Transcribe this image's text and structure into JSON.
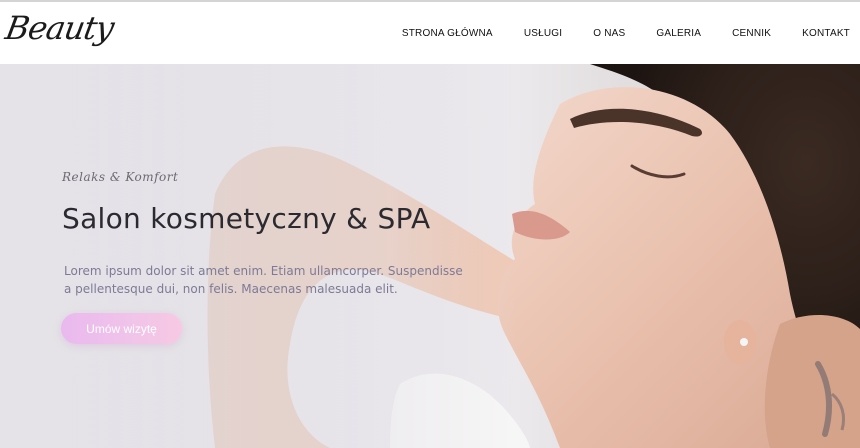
{
  "header": {
    "logo_text": "Beauty",
    "nav": [
      {
        "label": "STRONA GŁÓWNA"
      },
      {
        "label": "USŁUGI"
      },
      {
        "label": "O NAS"
      },
      {
        "label": "GALERIA"
      },
      {
        "label": "CENNIK"
      },
      {
        "label": "KONTAKT"
      }
    ]
  },
  "hero": {
    "tagline": "Relaks & Komfort",
    "headline": "Salon kosmetyczny & SPA",
    "lead": "Lorem ipsum dolor sit amet enim. Etiam ullamcorper. Suspendisse a pellentesque dui, non felis. Maecenas malesuada elit.",
    "cta_label": "Umów wizytę"
  },
  "colors": {
    "accent_start": "#e9b9ee",
    "accent_end": "#f7c9e3",
    "text_dark": "#2b2a31",
    "text_muted": "#7e7a95"
  }
}
